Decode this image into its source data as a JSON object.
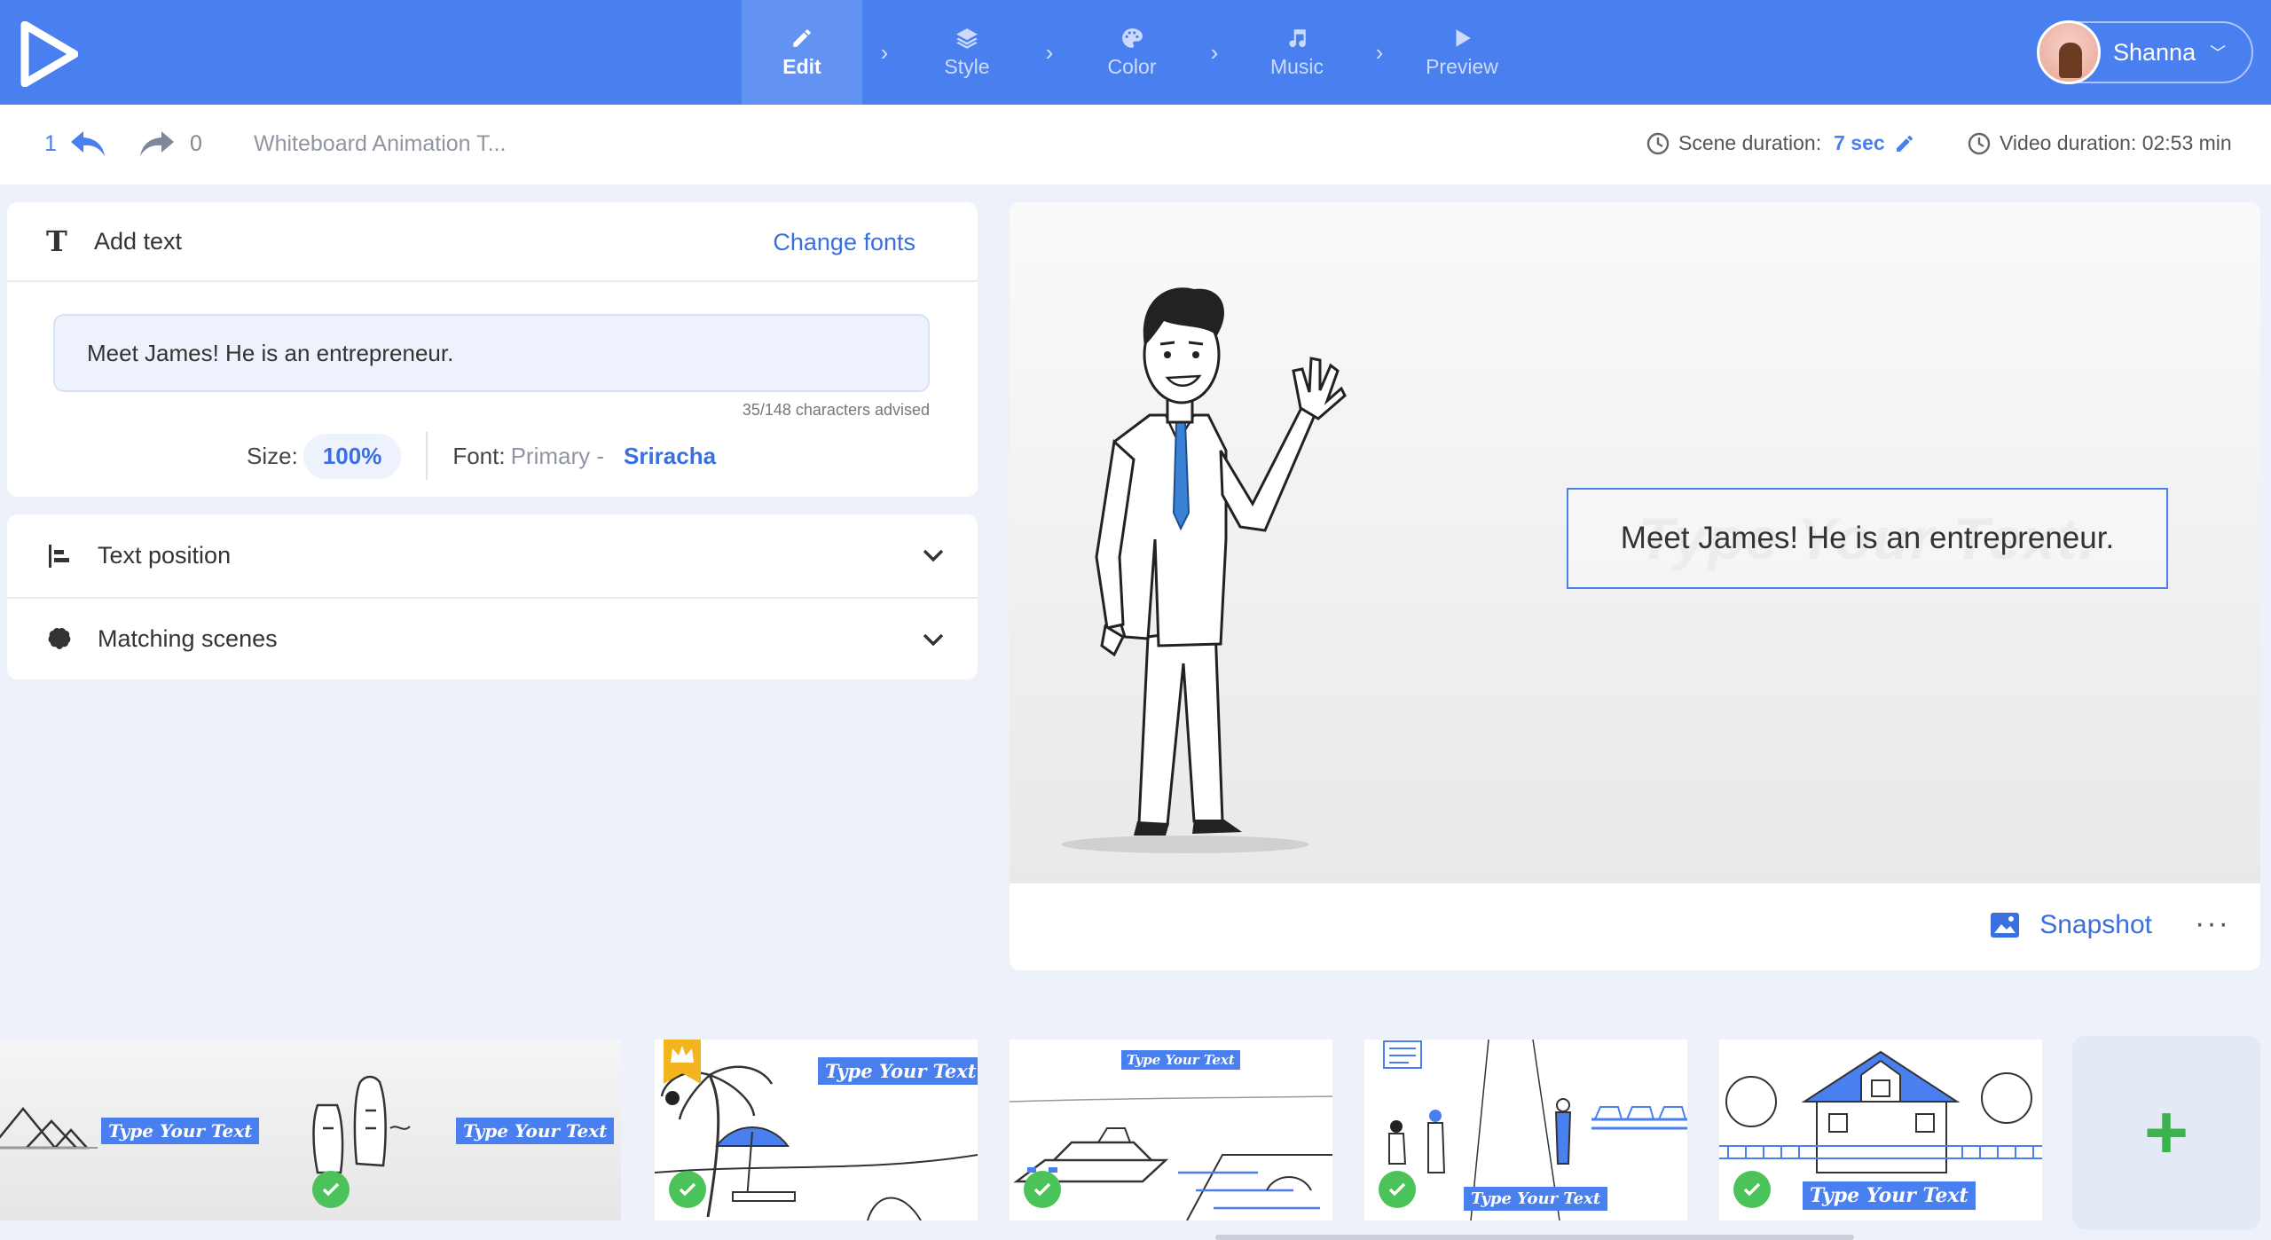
{
  "header": {
    "steps": [
      {
        "label": "Edit",
        "icon": "pencil-icon",
        "active": true
      },
      {
        "label": "Style",
        "icon": "layers-icon",
        "active": false
      },
      {
        "label": "Color",
        "icon": "palette-icon",
        "active": false
      },
      {
        "label": "Music",
        "icon": "music-note-icon",
        "active": false
      },
      {
        "label": "Preview",
        "icon": "play-icon",
        "active": false
      }
    ],
    "user_name": "Shanna",
    "accent_color": "#4a7ff0"
  },
  "toolbar": {
    "undo_count": "1",
    "redo_count": "0",
    "project_name": "Whiteboard Animation T...",
    "scene_duration_label": "Scene duration:",
    "scene_duration_value": "7 sec",
    "video_duration_label": "Video duration: 02:53 min"
  },
  "text_panel": {
    "title": "Add text",
    "change_fonts": "Change fonts",
    "text_value": "Meet James! He is an entrepreneur.",
    "char_count": "35/148 characters advised",
    "size_label": "Size:",
    "size_value": "100%",
    "font_label": "Font:",
    "font_primary": "Primary -",
    "font_name": "Sriracha"
  },
  "accordions": {
    "text_position": "Text position",
    "matching_scenes": "Matching scenes"
  },
  "preview": {
    "ghost_text": "Type Your Text.",
    "text": "Meet James! He is an entrepreneur.",
    "snapshot_label": "Snapshot",
    "more_label": "···"
  },
  "timeline": {
    "scene_texts": [
      "Type Your Text",
      "Type Your Text",
      "Type Your Text",
      "Type Your Text",
      "Type Your Text",
      "Type Your Text"
    ],
    "add_label": "+",
    "check_color": "#4cc25a"
  }
}
